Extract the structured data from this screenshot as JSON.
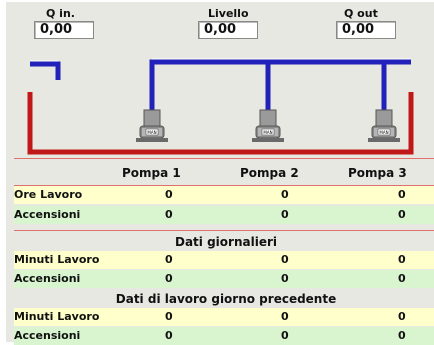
{
  "top": {
    "q_in": {
      "label": "Q  in.",
      "value": "0,00"
    },
    "livello": {
      "label": "Livello",
      "value": "0,00"
    },
    "q_out": {
      "label": "Q  out",
      "value": "0,00"
    }
  },
  "pumps": {
    "badge": "MAN",
    "columns": [
      "Pompa 1",
      "Pompa 2",
      "Pompa 3"
    ]
  },
  "table": {
    "rows_main": [
      {
        "label": "Ore Lavoro",
        "values": [
          "0",
          "0",
          "0"
        ],
        "style": "yellow"
      },
      {
        "label": "Accensioni",
        "values": [
          "0",
          "0",
          "0"
        ],
        "style": "green"
      }
    ],
    "section_daily": {
      "title": "Dati giornalieri",
      "rows": [
        {
          "label": "Minuti Lavoro",
          "values": [
            "0",
            "0",
            "0"
          ],
          "style": "yellow"
        },
        {
          "label": "Accensioni",
          "values": [
            "0",
            "0",
            "0"
          ],
          "style": "green"
        }
      ]
    },
    "section_prev": {
      "title": "Dati di lavoro giorno precedente",
      "rows": [
        {
          "label": "Minuti Lavoro",
          "values": [
            "0",
            "0",
            "0"
          ],
          "style": "yellow"
        },
        {
          "label": "Accensioni",
          "values": [
            "0",
            "0",
            "0"
          ],
          "style": "green"
        }
      ]
    }
  },
  "colors": {
    "tank": "#c01818",
    "pipe": "#2222bb",
    "pump_body": "#8a8a8a",
    "row_yellow": "#ffffcc",
    "row_green": "#d8f5d0"
  }
}
